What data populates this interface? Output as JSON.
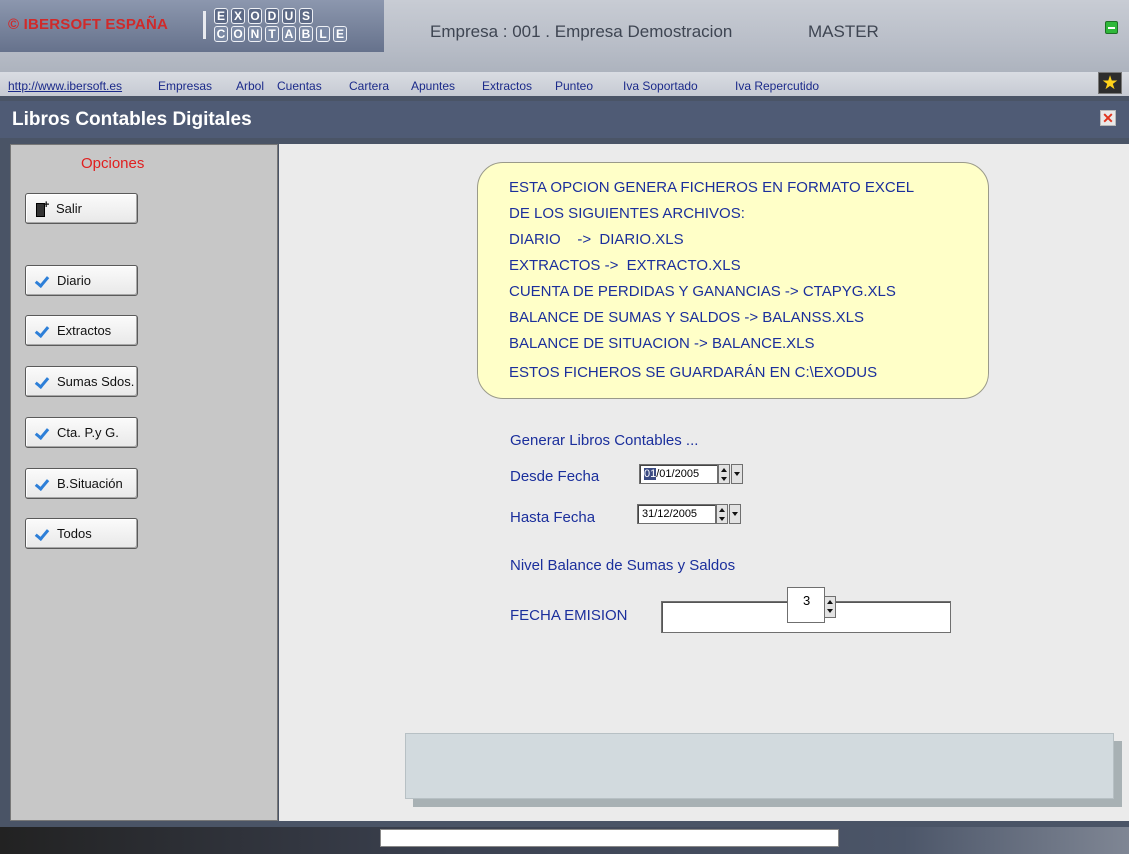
{
  "header": {
    "brand": "© IBERSOFT ESPAÑA",
    "logo_row1": [
      "E",
      "X",
      "O",
      "D",
      "U",
      "S"
    ],
    "logo_row2": [
      "C",
      "O",
      "N",
      "T",
      "A",
      "B",
      "L",
      "E"
    ],
    "empresa": "Empresa : 001 . Empresa Demostracion",
    "user": "MASTER"
  },
  "menu": {
    "items": [
      "http://www.ibersoft.es",
      "Empresas",
      "Arbol",
      "Cuentas",
      "Cartera",
      "Apuntes",
      "Extractos",
      "Punteo",
      "Iva Soportado",
      "Iva Repercutido"
    ],
    "star_icon": "★"
  },
  "form": {
    "title": "Libros Contables Digitales",
    "close_icon": "✕"
  },
  "sidebar": {
    "title": "Opciones",
    "buttons": [
      {
        "label": "Salir",
        "icon": "exit-icon"
      },
      {
        "label": "Diario",
        "icon": "check-icon"
      },
      {
        "label": "Extractos",
        "icon": "check-icon"
      },
      {
        "label": "Sumas Sdos.",
        "icon": "check-icon"
      },
      {
        "label": "Cta. P.y G.",
        "icon": "check-icon"
      },
      {
        "label": "B.Situación",
        "icon": "check-icon"
      },
      {
        "label": "Todos",
        "icon": "check-icon"
      }
    ]
  },
  "info": {
    "lines": [
      "ESTA OPCION GENERA FICHEROS EN FORMATO EXCEL",
      "DE LOS SIGUIENTES ARCHIVOS:",
      "DIARIO    ->  DIARIO.XLS",
      "EXTRACTOS ->  EXTRACTO.XLS",
      "CUENTA DE PERDIDAS Y GANANCIAS -> CTAPYG.XLS",
      "BALANCE DE SUMAS Y SALDOS -> BALANSS.XLS",
      "BALANCE DE SITUACION -> BALANCE.XLS",
      "ESTOS FICHEROS SE GUARDARÁN EN C:\\EXODUS"
    ]
  },
  "form_fields": {
    "generar_label": "Generar Libros Contables ...",
    "desde_label": "Desde Fecha",
    "desde_day": "01",
    "desde_rest": "/01/2005",
    "hasta_label": "Hasta Fecha",
    "hasta_value": "31/12/2005",
    "nivel_label": "Nivel Balance de Sumas y Saldos",
    "nivel_value": "3",
    "emision_label": "FECHA EMISION",
    "emision_value": ""
  },
  "colors": {
    "accent_text": "#1b2f9c",
    "title_bar": "#4f5b75",
    "options_title": "#e02020",
    "info_bg": "#ffffc8"
  }
}
